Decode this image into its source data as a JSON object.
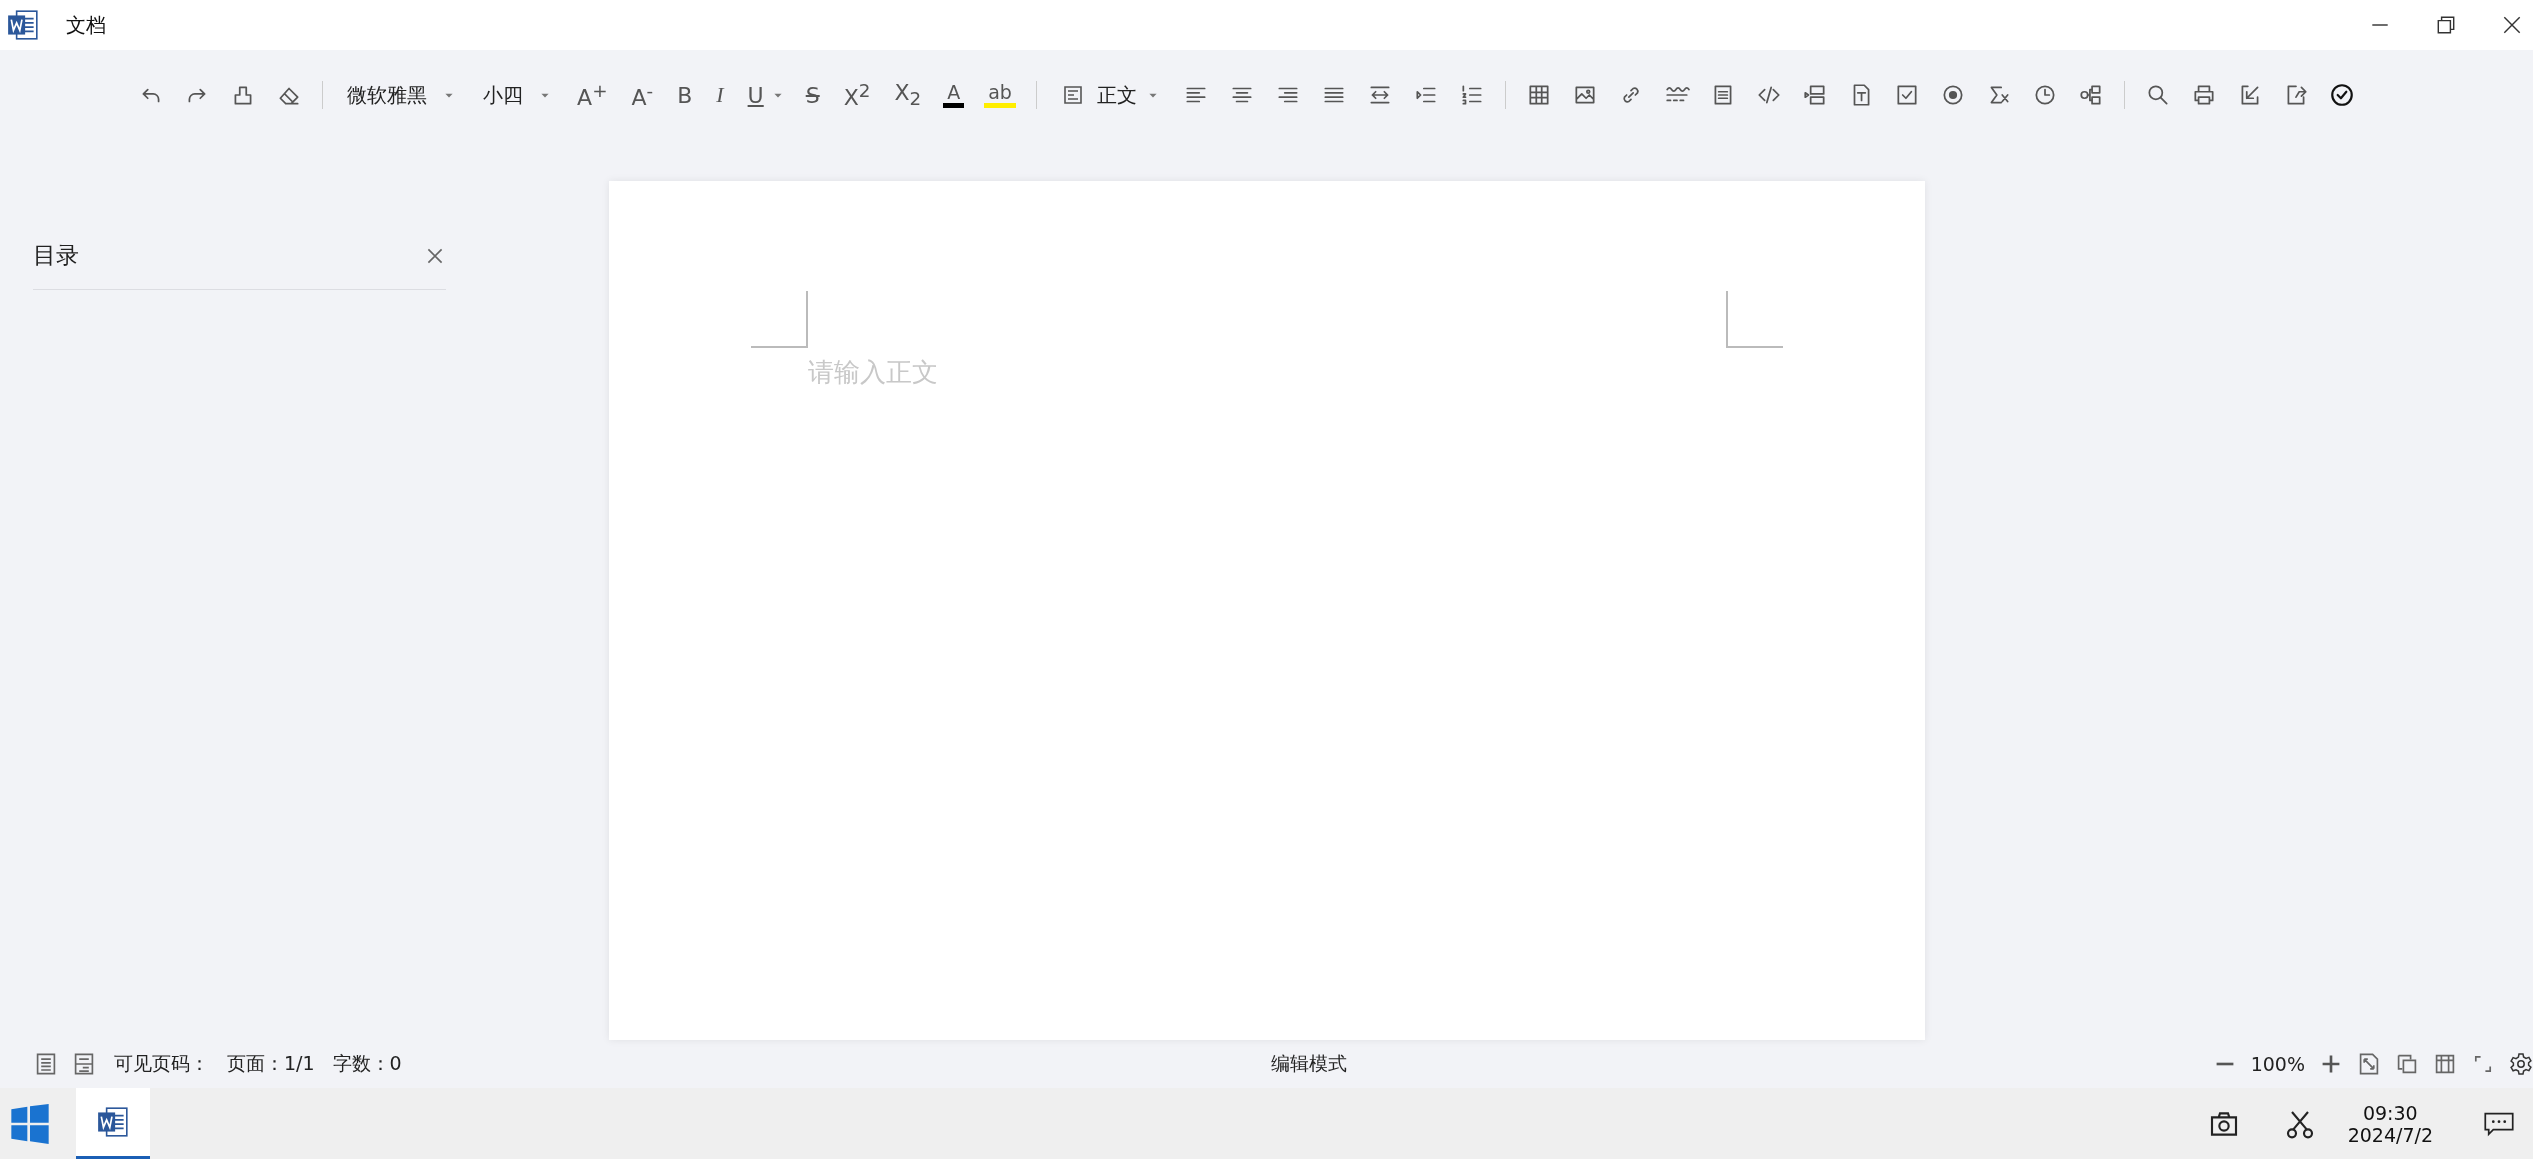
{
  "window": {
    "title": "文档"
  },
  "toolbar": {
    "font_select": {
      "value": "微软雅黑"
    },
    "size_select": {
      "value": "小四"
    },
    "format_buttons": [
      {
        "label": "A$^{+}$"
      },
      {
        "label": "A$^{-}$"
      },
      {
        "label": "B"
      },
      {
        "label": "I"
      },
      {
        "label": "U"
      },
      {
        "label": "S"
      },
      {
        "label": "X$^{2}$"
      },
      {
        "label": "X$_{2}$"
      }
    ],
    "color_buttons": [
      {
        "label": "A",
        "color": "#000000"
      },
      {
        "label": "ab",
        "color": "#ffee00"
      }
    ],
    "style_select": {
      "value": "正文"
    }
  },
  "outline": {
    "title": "目录"
  },
  "page": {
    "placeholder": "请输入正文"
  },
  "status_bar": {
    "visible_pages": "可见页码：",
    "page": "页面：1/1",
    "word_count": "字数：0",
    "mode": "编辑模式",
    "zoom": "100%"
  },
  "taskbar": {
    "apps": [
      {
        "selected": true
      }
    ],
    "time": "09:30",
    "date": "2024/7/2"
  }
}
